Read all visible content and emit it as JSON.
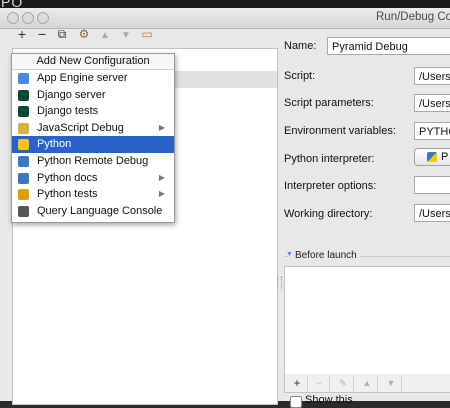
{
  "topstrip": {
    "text": "PO"
  },
  "window": {
    "title": "Run/Debug Co"
  },
  "toolbar": {
    "add": "+",
    "remove": "−",
    "copy": "⧉",
    "edit_defaults": "⚙",
    "move_up": "▲",
    "move_down": "▼",
    "folder": "▭"
  },
  "popup": {
    "header": "Add New Configuration",
    "items": [
      {
        "label": "App Engine server",
        "icon": "app-engine-icon",
        "color": "#4a86e8",
        "submenu": false
      },
      {
        "label": "Django server",
        "icon": "django-icon",
        "color": "#0c4b33",
        "submenu": false
      },
      {
        "label": "Django tests",
        "icon": "django-tests-icon",
        "color": "#0c4b33",
        "submenu": false
      },
      {
        "label": "JavaScript Debug",
        "icon": "javascript-debug-icon",
        "color": "#d8b046",
        "submenu": true
      },
      {
        "label": "Python",
        "icon": "python-icon",
        "color": "#f5c518",
        "submenu": false,
        "selected": true
      },
      {
        "label": "Python Remote Debug",
        "icon": "python-remote-debug-icon",
        "color": "#3b78c4",
        "submenu": false
      },
      {
        "label": "Python docs",
        "icon": "python-docs-icon",
        "color": "#3b78c4",
        "submenu": true
      },
      {
        "label": "Python tests",
        "icon": "python-tests-icon",
        "color": "#d9a200",
        "submenu": true
      },
      {
        "label": "Query Language Console",
        "icon": "console-icon",
        "color": "#555555",
        "submenu": false
      }
    ],
    "arrow": "▶"
  },
  "form": {
    "name_label": "Name:",
    "name_value": "Pyramid Debug",
    "script_label": "Script:",
    "script_value": "/Users",
    "params_label": "Script parameters:",
    "params_value": "/Users",
    "env_label": "Environment variables:",
    "env_value": "PYTHO",
    "interp_label": "Python interpreter:",
    "interp_value": "P",
    "interp_opts_label": "Interpreter options:",
    "interp_opts_value": "",
    "workdir_label": "Working directory:",
    "workdir_value": "/Users"
  },
  "before_launch": {
    "title": "Before launch",
    "add": "+",
    "remove": "−",
    "edit": "✎",
    "up": "▲",
    "down": "▼",
    "show_label": "Show this"
  }
}
